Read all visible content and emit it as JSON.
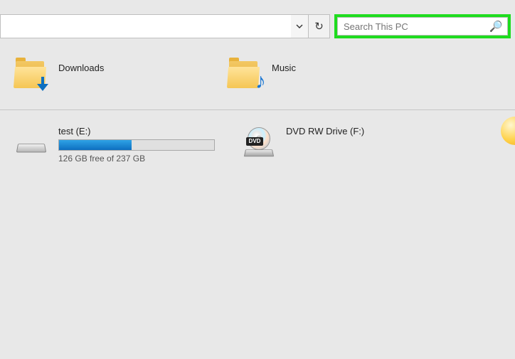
{
  "topbar": {
    "search_placeholder": "Search This PC"
  },
  "folders": {
    "downloads": {
      "label": "Downloads"
    },
    "music": {
      "label": "Music"
    }
  },
  "drives": {
    "test": {
      "name": "test (E:)",
      "free_text": "126 GB free of 237 GB"
    },
    "dvd": {
      "name": "DVD RW Drive (F:)",
      "badge": "DVD"
    }
  }
}
